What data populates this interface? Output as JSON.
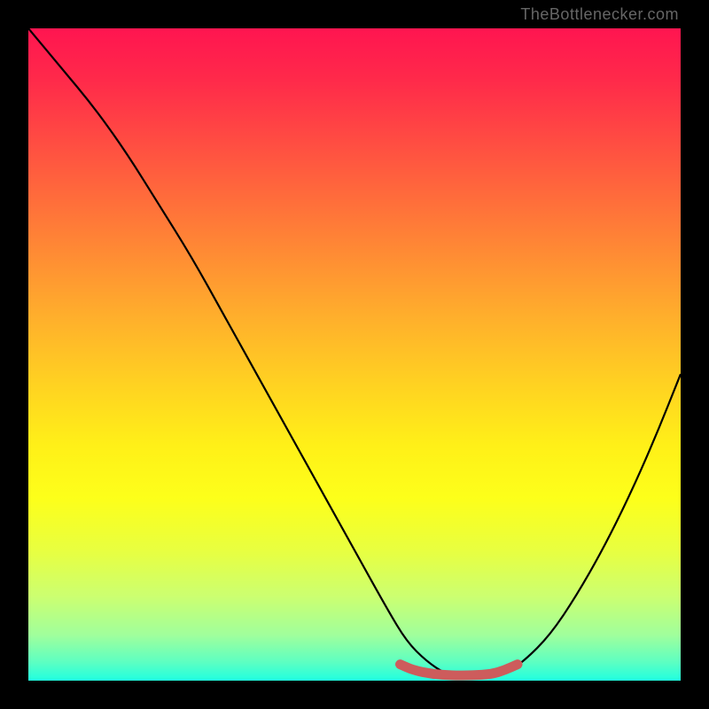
{
  "attribution": "TheBottlenecker.com",
  "chart_data": {
    "type": "line",
    "title": "",
    "xlabel": "",
    "ylabel": "",
    "xlim": [
      0,
      100
    ],
    "ylim": [
      0,
      100
    ],
    "series": [
      {
        "name": "bottleneck-curve",
        "x": [
          0,
          5,
          10,
          15,
          20,
          25,
          30,
          35,
          40,
          45,
          50,
          55,
          58,
          61,
          64,
          67,
          70,
          73,
          76,
          80,
          84,
          88,
          92,
          96,
          100
        ],
        "y": [
          100,
          94,
          88,
          81,
          73,
          65,
          56,
          47,
          38,
          29,
          20,
          11,
          6,
          3,
          1,
          0.3,
          0.3,
          1,
          3,
          7,
          13,
          20,
          28,
          37,
          47
        ]
      },
      {
        "name": "optimal-band",
        "x": [
          57,
          59,
          62,
          65,
          68,
          71,
          73,
          75
        ],
        "y": [
          2.5,
          1.6,
          1.0,
          0.8,
          0.8,
          1.0,
          1.6,
          2.5
        ]
      }
    ],
    "colors": {
      "curve": "#000000",
      "band": "#cd5c5c"
    }
  }
}
